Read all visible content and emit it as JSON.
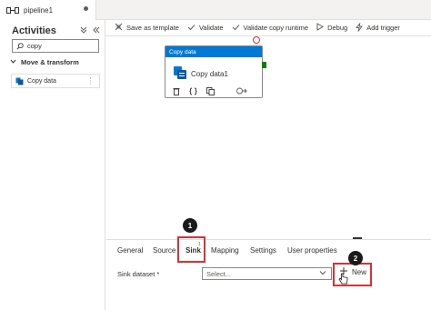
{
  "tab": {
    "title": "pipeline1"
  },
  "activities": {
    "title": "Activities",
    "collapse_icon": "collapse-icon",
    "hide_icon": "double-chevron-left-icon",
    "search_value": "copy",
    "group_label": "Move & transform",
    "items": [
      {
        "label": "Copy data",
        "icon": "copy-data-icon"
      }
    ]
  },
  "toolbar": {
    "save_template": "Save as template",
    "validate": "Validate",
    "validate_copy": "Validate copy runtime",
    "debug": "Debug",
    "add_trigger": "Add trigger"
  },
  "activity_box": {
    "header": "Copy data",
    "name": "Copy data1",
    "actions": [
      "delete-icon",
      "code-icon",
      "clone-icon",
      "output-arrow-icon"
    ]
  },
  "properties": {
    "tabs": [
      "General",
      "Source",
      "Sink",
      "Mapping",
      "Settings",
      "User properties"
    ],
    "active_tab": "Sink",
    "sink_superscript": "1",
    "sink_dataset_label": "Sink dataset",
    "required_mark": "*",
    "select_placeholder": "Select...",
    "new_label": "New"
  },
  "callouts": {
    "one": "1",
    "two": "2"
  },
  "colors": {
    "accent": "#0078d4",
    "highlight": "#d13438",
    "success": "#107c10"
  }
}
